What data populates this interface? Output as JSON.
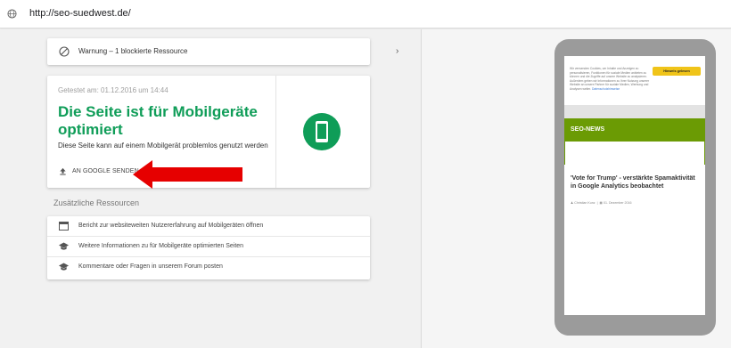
{
  "browser": {
    "url": "http://seo-suedwest.de/",
    "icon": "globe-icon"
  },
  "warning": {
    "text": "Warnung – 1 blockierte Ressource",
    "icon": "ban-icon",
    "chevron": "›"
  },
  "result": {
    "tested_on": "Getestet am: 01.12.2016 um 14:44",
    "headline": "Die Seite ist für Mobilgeräte optimiert",
    "subtext": "Diese Seite kann auf einem Mobilgerät problemlos genutzt werden",
    "send_label": "AN GOOGLE SENDEN",
    "status_color": "#0f9d58"
  },
  "resources": {
    "title": "Zusätzliche Ressourcen",
    "items": [
      {
        "label": "Bericht zur websiteweiten Nutzererfahrung auf Mobilgeräten öffnen",
        "icon": "browser-window-icon"
      },
      {
        "label": "Weitere Informationen zu für Mobilgeräte optimierten Seiten",
        "icon": "school-cap-icon"
      },
      {
        "label": "Kommentare oder Fragen in unserem Forum posten",
        "icon": "school-cap-icon"
      }
    ]
  },
  "preview": {
    "cookie_text": "Wir verwenden Cookies, um Inhalte und Anzeigen zu personalisieren, Funktionen für soziale Medien anbieten zu können und die Zugriffe auf unsere Website zu analysieren. Außerdem geben wir Informationen zu Ihrer Nutzung unserer Website an unsere Partner für soziale Medien, Werbung und Analysen weiter.",
    "cookie_link": "Datenschutzhinweise",
    "cookie_button": "Hinweis gelesen",
    "section": "SEO-NEWS",
    "article_title": "'Vote for Trump' - verstärkte Spamaktivität in Google Analytics beobachtet",
    "author": "Christian Kunz",
    "date": "01. Dezember 2016",
    "accent_color": "#6b9b04"
  }
}
